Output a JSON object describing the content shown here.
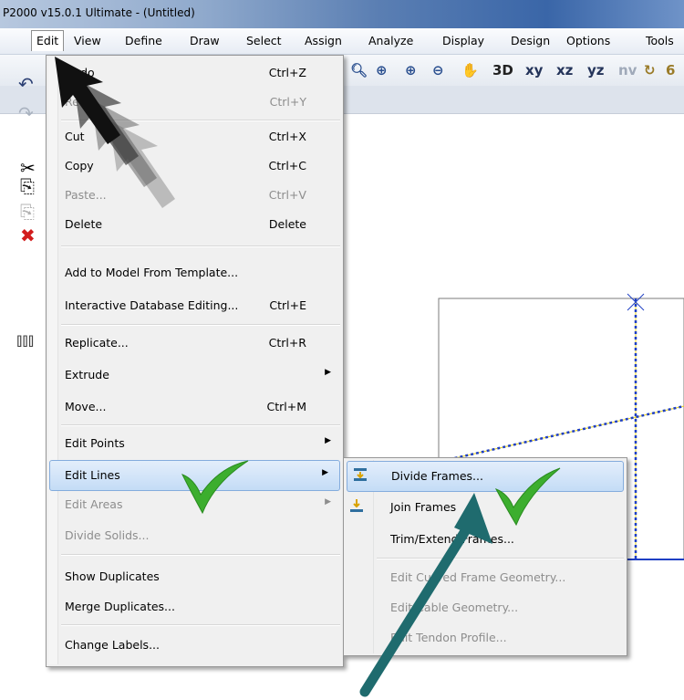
{
  "window": {
    "title": "P2000 v15.0.1 Ultimate  - (Untitled)"
  },
  "menubar": [
    "Edit",
    "View",
    "Define",
    "Draw",
    "Select",
    "Assign",
    "Analyze",
    "Display",
    "Design",
    "Options",
    "Tools"
  ],
  "toolbar": {
    "view_buttons": [
      "xy",
      "xz",
      "yz",
      "nv"
    ]
  },
  "edit_menu": {
    "undo": {
      "label": "Undo",
      "shortcut": "Ctrl+Z"
    },
    "redo": {
      "label": "Redo",
      "shortcut": "Ctrl+Y"
    },
    "cut": {
      "label": "Cut",
      "shortcut": "Ctrl+X"
    },
    "copy": {
      "label": "Copy",
      "shortcut": "Ctrl+C"
    },
    "paste": {
      "label": "Paste...",
      "shortcut": "Ctrl+V"
    },
    "delete": {
      "label": "Delete",
      "shortcut": "Delete"
    },
    "add_template": {
      "label": "Add to Model From Template..."
    },
    "db_editing": {
      "label": "Interactive Database Editing...",
      "shortcut": "Ctrl+E"
    },
    "replicate": {
      "label": "Replicate...",
      "shortcut": "Ctrl+R"
    },
    "extrude": {
      "label": "Extrude"
    },
    "move": {
      "label": "Move...",
      "shortcut": "Ctrl+M"
    },
    "edit_points": {
      "label": "Edit Points"
    },
    "edit_lines": {
      "label": "Edit Lines"
    },
    "edit_areas": {
      "label": "Edit Areas"
    },
    "divide_solids": {
      "label": "Divide Solids..."
    },
    "show_duplicates": {
      "label": "Show Duplicates"
    },
    "merge_duplicates": {
      "label": "Merge Duplicates..."
    },
    "change_labels": {
      "label": "Change Labels..."
    }
  },
  "edit_lines_submenu": {
    "divide_frames": "Divide Frames...",
    "join_frames": "Join Frames",
    "trim_extend": "Trim/Extend Frames...",
    "curved_geometry": "Edit Curved Frame Geometry...",
    "cable_geometry": "Edit Cable Geometry...",
    "tendon_profile": "Edit Tendon Profile..."
  },
  "colors": {
    "checkmark": "#3cae2e",
    "annotation_arrow": "#1f6b6e",
    "frame_dashed": "#1f3fc4",
    "frame_dash_accent": "#e8d21a",
    "highlight": "#c4dcf6"
  }
}
